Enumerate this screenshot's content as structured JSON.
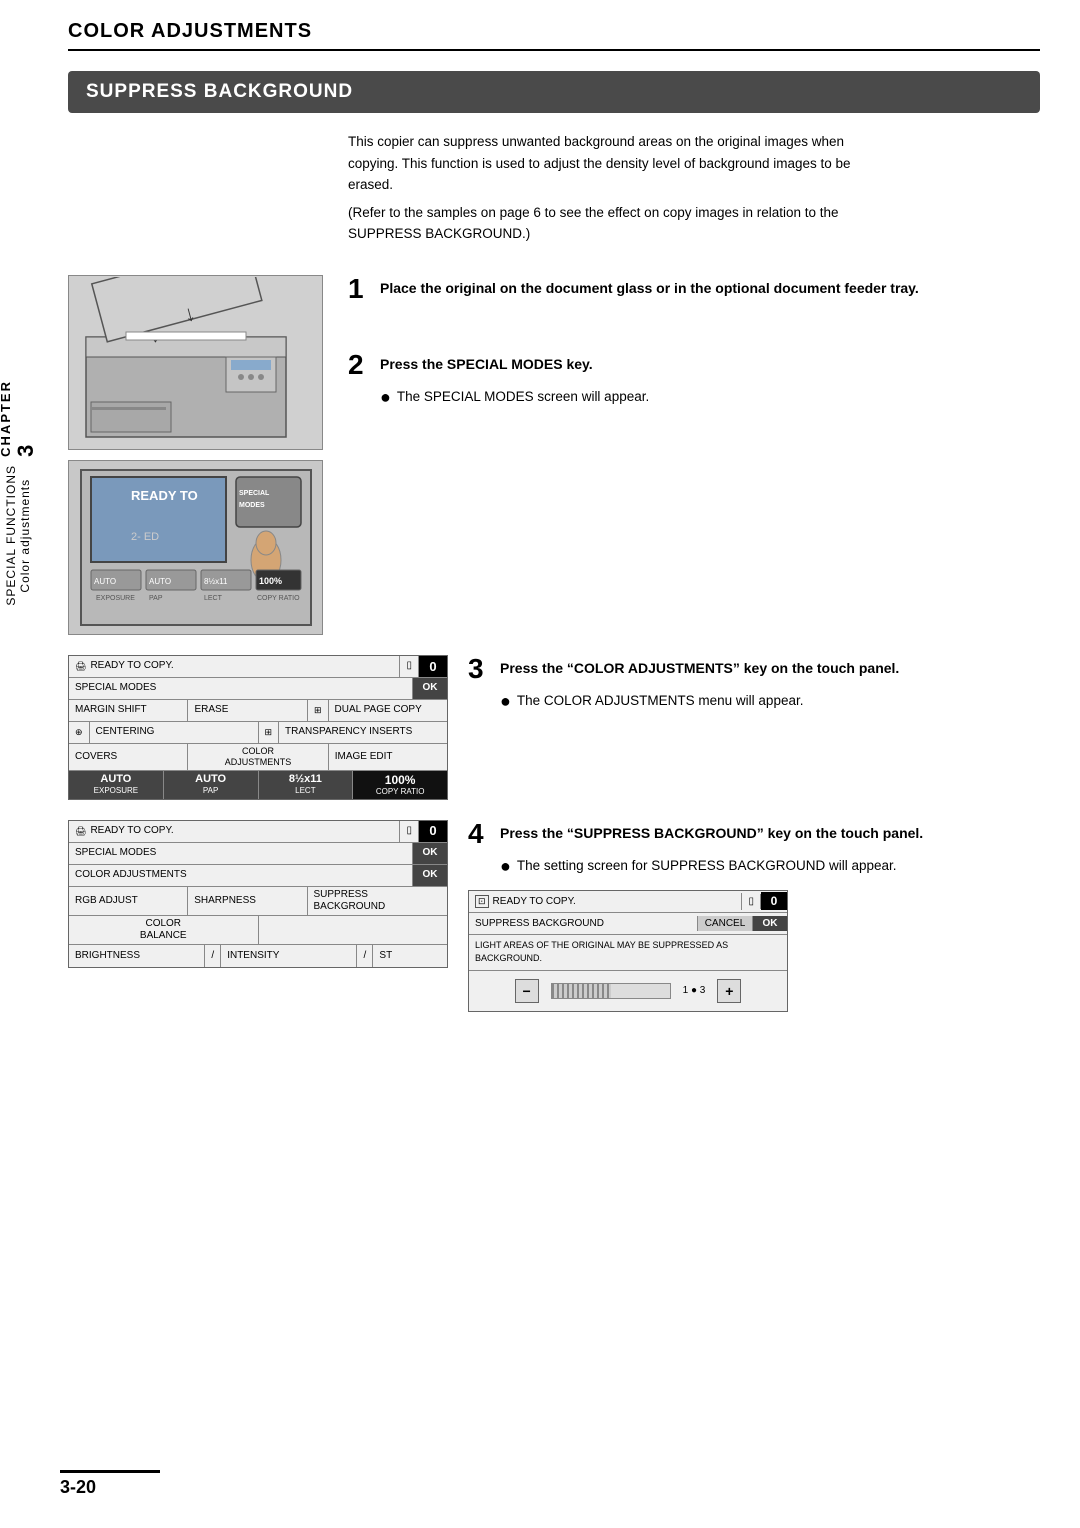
{
  "header": {
    "title": "COLOR ADJUSTMENTS",
    "underline": true
  },
  "section": {
    "title": "SUPPRESS BACKGROUND"
  },
  "intro": {
    "para1": "This copier can suppress unwanted background areas on the original images when copying. This function is used to adjust the density level of background images to be erased.",
    "para2": "(Refer to the samples on page 6 to see the effect on copy images in relation to the SUPPRESS BACKGROUND.)"
  },
  "sidebar": {
    "chapter_label": "CHAPTER",
    "chapter_number": "3",
    "functions_label": "SPECIAL FUNCTIONS",
    "sub_label": "Color adjustments"
  },
  "steps": [
    {
      "number": "1",
      "title": "Place the original on the document glass or in the optional document feeder tray.",
      "bullets": []
    },
    {
      "number": "2",
      "title": "Press the SPECIAL MODES key.",
      "bullets": [
        "The SPECIAL MODES screen will appear."
      ]
    },
    {
      "number": "3",
      "title": "Press the “COLOR ADJUSTMENTS” key on the touch panel.",
      "bullets": [
        "The COLOR ADJUSTMENTS menu will appear."
      ]
    },
    {
      "number": "4",
      "title": "Press the “SUPPRESS BACKGROUND” key on the touch panel.",
      "bullets": [
        "The setting screen for SUPPRESS BACKGROUND will appear."
      ]
    }
  ],
  "touch_panel_1": {
    "status": "READY TO COPY.",
    "modes": "SPECIAL MODES",
    "rows": [
      {
        "left": "MARGIN SHIFT",
        "middle": "ERASE",
        "right_icon": "⎘",
        "right": "DUAL PAGE COPY"
      },
      {
        "left_icon": "❖",
        "left": "CENTERING",
        "right_icon": "❖",
        "right": "TRANSPARENCY INSERTS"
      },
      {
        "left": "COVERS",
        "middle": "COLOR ADJUSTMENTS",
        "right": "IMAGE EDIT"
      }
    ],
    "bottom": {
      "col1_label": "AUTO",
      "col1_sub": "EXPOSURE",
      "col2_label": "AUTO",
      "col2_sub": "PAP",
      "col3_label": "8½x11",
      "col3_sub": "LECT",
      "col4_label": "100%",
      "col4_sub": "COPY RATIO"
    }
  },
  "touch_panel_2": {
    "status": "READY TO COPY.",
    "modes": "SPECIAL MODES",
    "color_adj": "COLOR ADJUSTMENTS",
    "rows": [
      {
        "left": "RGB ADJUST",
        "middle": "SHARPNESS",
        "right": "SUPPRESS BACKGROUND"
      },
      {
        "left": "COLOR BALANCE",
        "right": ""
      },
      {
        "left": "BRIGHTNESS",
        "sep1": "/",
        "middle": "INTENSITY",
        "sep2": "/",
        "right": "ST"
      }
    ]
  },
  "touch_panel_3": {
    "status": "READY TO COPY.",
    "feature": "SUPPRESS BACKGROUND",
    "cancel": "CANCEL",
    "ok": "OK",
    "message": "LIGHT AREAS OF THE ORIGINAL MAY BE SUPPRESSED AS BACKGROUND.",
    "slider_value": "1 ● 3",
    "slider_minus": "−",
    "slider_plus": "+"
  },
  "special_modes_screen": {
    "line1": "SPECIAL",
    "line2": "MODES",
    "display": "READY TO",
    "indicator": "2-  ED"
  },
  "page_number": "3-20"
}
